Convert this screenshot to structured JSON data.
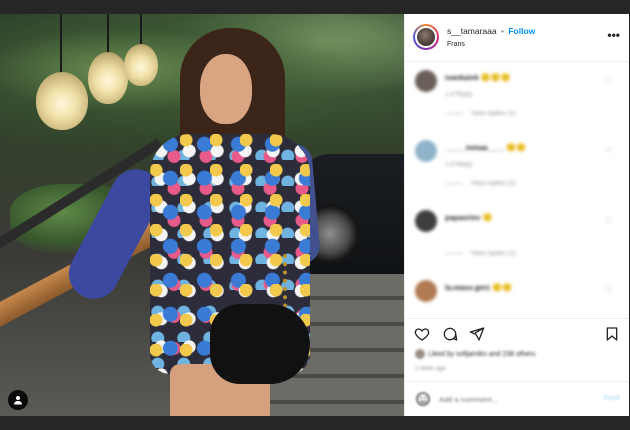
{
  "post": {
    "username": "s__tamaraaa",
    "separator": "•",
    "follow_label": "Follow",
    "location": "Frans",
    "more_label": "•••"
  },
  "comments": [
    {
      "name": "ivankaivk",
      "emoji": "🙂🙂🙂",
      "meta": "1 d   Reply",
      "replies": "View replies (1)",
      "avatar_color": "#6a5f58"
    },
    {
      "name": "_____mmaa____",
      "emoji": "🙂🙂",
      "meta": "1 d   Reply",
      "replies": "View replies (1)",
      "avatar_color": "#8fb3c9"
    },
    {
      "name": "papaoriev",
      "emoji": "🙂",
      "meta": "",
      "replies": "View replies (1)",
      "avatar_color": "#3e3e3e"
    },
    {
      "name": "la.mase.gm1",
      "emoji": "🙂🙂",
      "meta": "",
      "replies": "",
      "avatar_color": "#b07a52"
    }
  ],
  "likes": {
    "text": "Liked by sofijamiks and 238 others"
  },
  "time_text": "1 week ago",
  "add_comment": {
    "placeholder": "Add a comment...",
    "post_label": "Post"
  },
  "colors": {
    "accent": "#0095f6",
    "text": "#262626",
    "muted": "#8e8e8e"
  },
  "icons": [
    "heart-icon",
    "comment-icon",
    "share-icon",
    "bookmark-icon",
    "smile-icon",
    "user-icon"
  ]
}
